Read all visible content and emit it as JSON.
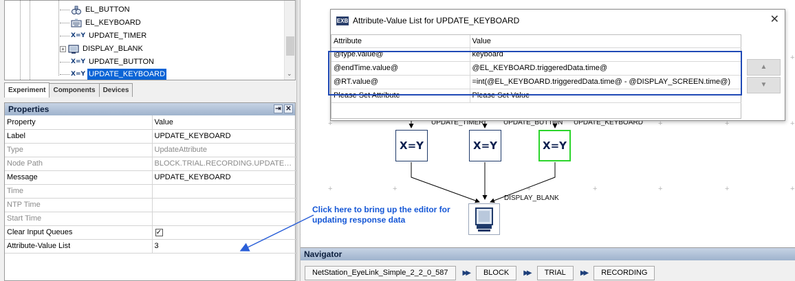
{
  "tree": {
    "items": [
      {
        "label": "EL_BUTTON",
        "icon": "button-device-icon"
      },
      {
        "label": "EL_KEYBOARD",
        "icon": "keyboard-icon"
      },
      {
        "label": "UPDATE_TIMER",
        "icon": "update-attribute-icon",
        "icon_text": "X=Y"
      },
      {
        "label": "DISPLAY_BLANK",
        "icon": "display-icon",
        "expander": "+"
      },
      {
        "label": "UPDATE_BUTTON",
        "icon": "update-attribute-icon",
        "icon_text": "X=Y"
      },
      {
        "label": "UPDATE_KEYBOARD",
        "icon": "update-attribute-icon",
        "icon_text": "X=Y",
        "selected": true
      }
    ]
  },
  "tabs": [
    "Experiment",
    "Components",
    "Devices"
  ],
  "properties": {
    "title": "Properties",
    "buttons": [
      "⇥",
      "✕"
    ],
    "columns": [
      "Property",
      "Value"
    ],
    "rows": [
      {
        "name": "Label",
        "value": "UPDATE_KEYBOARD",
        "readonly": false
      },
      {
        "name": "Type",
        "value": "UpdateAttribute",
        "readonly": true
      },
      {
        "name": "Node Path",
        "value": "BLOCK.TRIAL.RECORDING.UPDATE_KEY...",
        "readonly": true
      },
      {
        "name": "Message",
        "value": "UPDATE_KEYBOARD",
        "readonly": false
      },
      {
        "name": "Time",
        "value": "",
        "readonly": true
      },
      {
        "name": "NTP Time",
        "value": "",
        "readonly": true
      },
      {
        "name": "Start Time",
        "value": "",
        "readonly": true
      },
      {
        "name": "Clear Input Queues",
        "value": "",
        "checkbox": true,
        "checked": true,
        "readonly": false
      },
      {
        "name": "Attribute-Value List",
        "value": "3",
        "readonly": false
      }
    ]
  },
  "dialog": {
    "title": "Attribute-Value List for UPDATE_KEYBOARD",
    "icon_text": "EXB",
    "close": "✕",
    "columns": [
      "Attribute",
      "Value"
    ],
    "rows": [
      {
        "attribute": "@type.value@",
        "value": "keyboard"
      },
      {
        "attribute": "@endTime.value@",
        "value": "@EL_KEYBOARD.triggeredData.time@"
      },
      {
        "attribute": "@RT.value@",
        "value": "=int(@EL_KEYBOARD.triggeredData.time@ - @DISPLAY_SCREEN.time@)"
      },
      {
        "attribute": "Please Set Attribute",
        "value": "Please Set Value"
      }
    ],
    "buttons": [
      "▲",
      "▼"
    ]
  },
  "canvas": {
    "nodes": [
      {
        "label": "UPDATE_TIMER",
        "icon_text": "X=Y"
      },
      {
        "label": "UPDATE_BUTTON",
        "icon_text": "X=Y"
      },
      {
        "label": "UPDATE_KEYBOARD",
        "icon_text": "X=Y",
        "highlighted": true,
        "highlight_color": "#2bd52b"
      },
      {
        "label": "DISPLAY_BLANK",
        "icon": "display-icon"
      }
    ],
    "annotation": "Click here to bring up the editor for updating response data",
    "annotation_color": "#1557d6"
  },
  "navigator": {
    "title": "Navigator",
    "crumbs": [
      "NetStation_EyeLink_Simple_2_2_0_587",
      "BLOCK",
      "TRIAL",
      "RECORDING"
    ],
    "separator": "▶▶"
  }
}
